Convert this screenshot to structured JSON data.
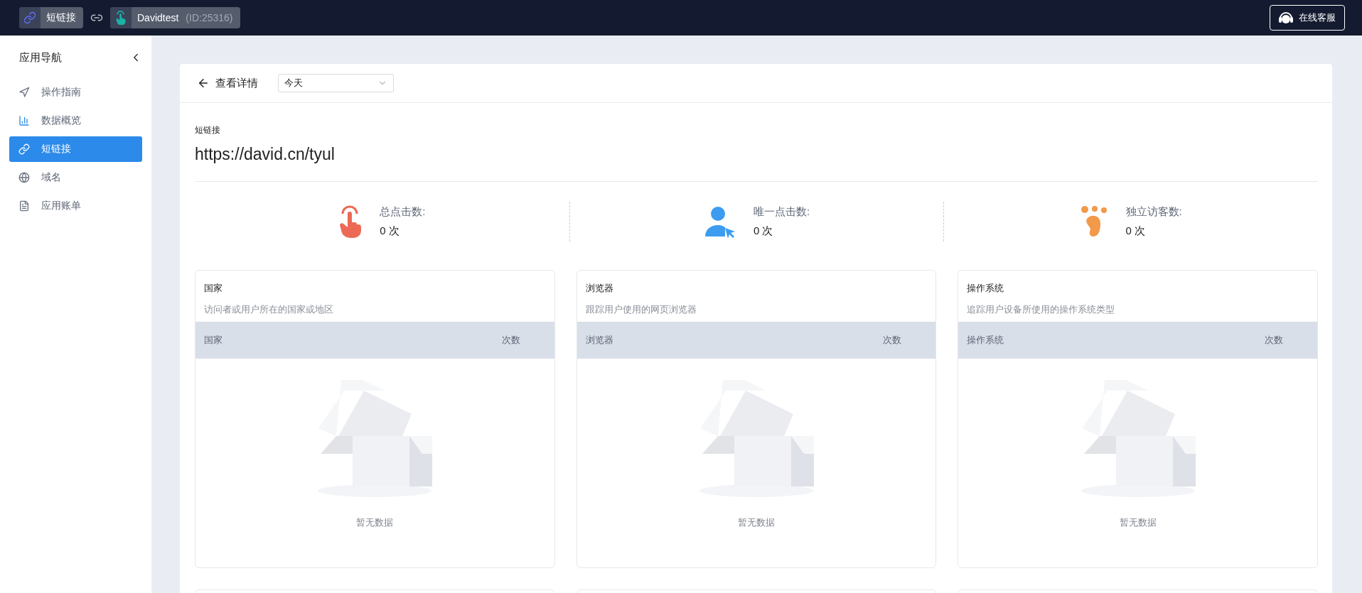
{
  "top_bar": {
    "app": {
      "name": "短链接"
    },
    "project": {
      "name": "Davidtest",
      "id": "(ID:25316)"
    },
    "support_button": "在线客服"
  },
  "sidebar": {
    "title": "应用导航",
    "items": [
      {
        "label": "操作指南",
        "selected": false
      },
      {
        "label": "数据概览",
        "selected": false
      },
      {
        "label": "短链接",
        "selected": true
      },
      {
        "label": "域名",
        "selected": false
      },
      {
        "label": "应用账单",
        "selected": false
      }
    ]
  },
  "detail": {
    "back_label": "查看详情",
    "period": {
      "value": "今天"
    },
    "link_label": "短链接",
    "link_url": "https://david.cn/tyul",
    "stats": [
      {
        "label": "总点击数:",
        "value": "0 次"
      },
      {
        "label": "唯一点击数:",
        "value": "0 次"
      },
      {
        "label": "独立访客数:",
        "value": "0 次"
      }
    ],
    "panels": [
      {
        "title": "国家",
        "description": "访问者或用户所在的国家或地区",
        "columns": [
          "国家",
          "次数"
        ],
        "empty_text": "暂无数据"
      },
      {
        "title": "浏览器",
        "description": "跟踪用户使用的网页浏览器",
        "columns": [
          "浏览器",
          "次数"
        ],
        "empty_text": "暂无数据"
      },
      {
        "title": "操作系统",
        "description": "追踪用户设备所使用的操作系统类型",
        "columns": [
          "操作系统",
          "次数"
        ],
        "empty_text": "暂无数据"
      }
    ]
  }
}
